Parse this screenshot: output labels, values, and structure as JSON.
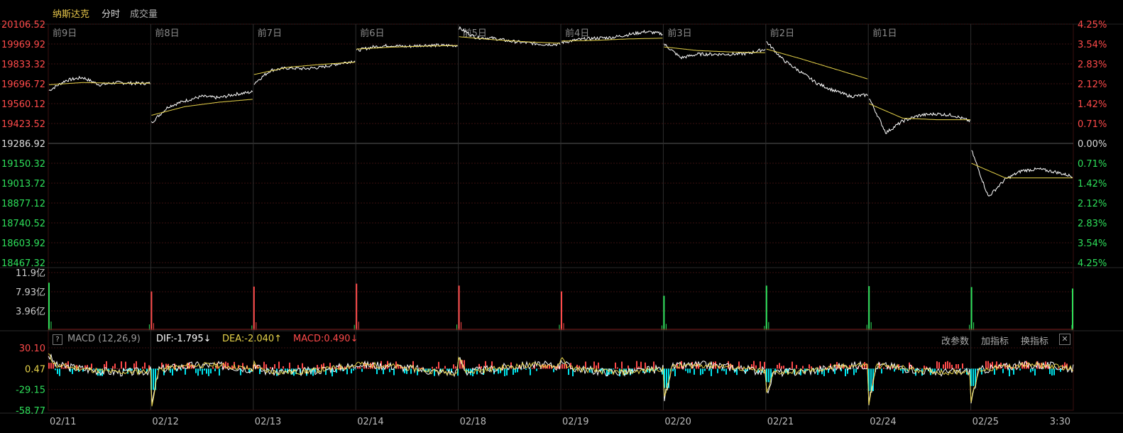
{
  "header": {
    "title": "纳斯达克",
    "tab_intraday": "分时",
    "tab_volume": "成交量"
  },
  "colors": {
    "up": "#ff4a4a",
    "down": "#2ee05a",
    "price_line": "#ffffff",
    "avg_line": "#e8d44a",
    "grid": "#3a1010",
    "macd_neg": "#00e5ee"
  },
  "chart_data": [
    {
      "type": "line",
      "panel": "price",
      "title": "",
      "y_left_ticks": [
        "20106.52",
        "19969.92",
        "19833.32",
        "19696.72",
        "19560.12",
        "19423.52",
        "19286.92",
        "19150.32",
        "19013.72",
        "18877.12",
        "18740.52",
        "18603.92",
        "18467.32"
      ],
      "y_right_ticks": [
        "4.25%",
        "3.54%",
        "2.83%",
        "2.12%",
        "1.42%",
        "0.71%",
        "0.00%",
        "0.71%",
        "1.42%",
        "2.12%",
        "2.83%",
        "3.54%",
        "4.25%"
      ],
      "ylim": [
        18467.32,
        20106.52
      ],
      "base": 19286.92,
      "day_labels": [
        "前9日",
        "前8日",
        "前7日",
        "前6日",
        "前5日",
        "前4日",
        "前3日",
        "前2日",
        "前1日",
        ""
      ],
      "series": [
        {
          "points": [
            [
              19650,
              19720,
              19740,
              19690,
              19705,
              19700,
              19700
            ],
            [
              19430,
              19540,
              19580,
              19610,
              19600,
              19625,
              19640
            ],
            [
              19700,
              19790,
              19805,
              19800,
              19810,
              19835,
              19855
            ],
            [
              19925,
              19950,
              19960,
              19952,
              19962,
              19960,
              19960
            ],
            [
              20080,
              20015,
              20010,
              19990,
              19978,
              19968,
              19968
            ],
            [
              19980,
              20000,
              20010,
              20015,
              20035,
              20055,
              20040
            ],
            [
              19970,
              19875,
              19900,
              19900,
              19900,
              19905,
              19935
            ],
            [
              19985,
              19860,
              19780,
              19700,
              19650,
              19610,
              19620
            ],
            [
              19600,
              19360,
              19440,
              19480,
              19490,
              19480,
              19440
            ],
            [
              19240,
              18920,
              19040,
              19100,
              19110,
              19090,
              19060
            ]
          ]
        },
        {
          "points": [
            [
              19690,
              19705,
              19700,
              19700
            ],
            [
              19480,
              19540,
              19570,
              19590
            ],
            [
              19760,
              19810,
              19830,
              19845
            ],
            [
              19935,
              19948,
              19955,
              19960
            ],
            [
              20020,
              20000,
              19985,
              19975
            ],
            [
              19990,
              19995,
              20005,
              20010
            ],
            [
              19950,
              19925,
              19915,
              19910
            ],
            [
              19935,
              19870,
              19800,
              19730
            ],
            [
              19560,
              19460,
              19450,
              19450
            ],
            [
              19150,
              19050,
              19050,
              19050
            ]
          ]
        }
      ]
    },
    {
      "type": "bar",
      "panel": "volume",
      "title": "",
      "y_ticks": [
        "11.9亿",
        "7.93亿",
        "3.96亿"
      ],
      "ylim": [
        0,
        11.9
      ],
      "unit": "亿",
      "open_spikes": [
        9.8,
        8.0,
        9.0,
        9.6,
        9.2,
        8.0,
        7.1,
        9.2,
        9.1,
        8.9
      ],
      "spike_up": [
        false,
        true,
        true,
        true,
        true,
        true,
        false,
        false,
        false,
        false
      ],
      "last_value": 8.6,
      "baseline": 0.15
    },
    {
      "type": "line",
      "panel": "macd",
      "title": "",
      "y_ticks": [
        "30.10",
        "0.47",
        "-29.15",
        "-58.77"
      ],
      "ylim": [
        -58.77,
        30.1
      ],
      "zero": 0.47,
      "dif_open": [
        15,
        -55,
        10,
        5,
        22,
        12,
        -50,
        -35,
        -58,
        -45
      ]
    }
  ],
  "macd_header": {
    "help": "?",
    "name": "MACD (12,26,9)",
    "dif": "DIF:-1.795↓",
    "dea": "DEA:-2.040↑",
    "macd": "MACD:0.490↓",
    "action_params": "改参数",
    "action_add": "加指标",
    "action_switch": "换指标",
    "close": "✕"
  },
  "x_axis": {
    "labels": [
      "02/11",
      "02/12",
      "02/13",
      "02/14",
      "02/18",
      "02/19",
      "02/20",
      "02/21",
      "02/24",
      "02/25"
    ],
    "last_label": "3:30"
  }
}
